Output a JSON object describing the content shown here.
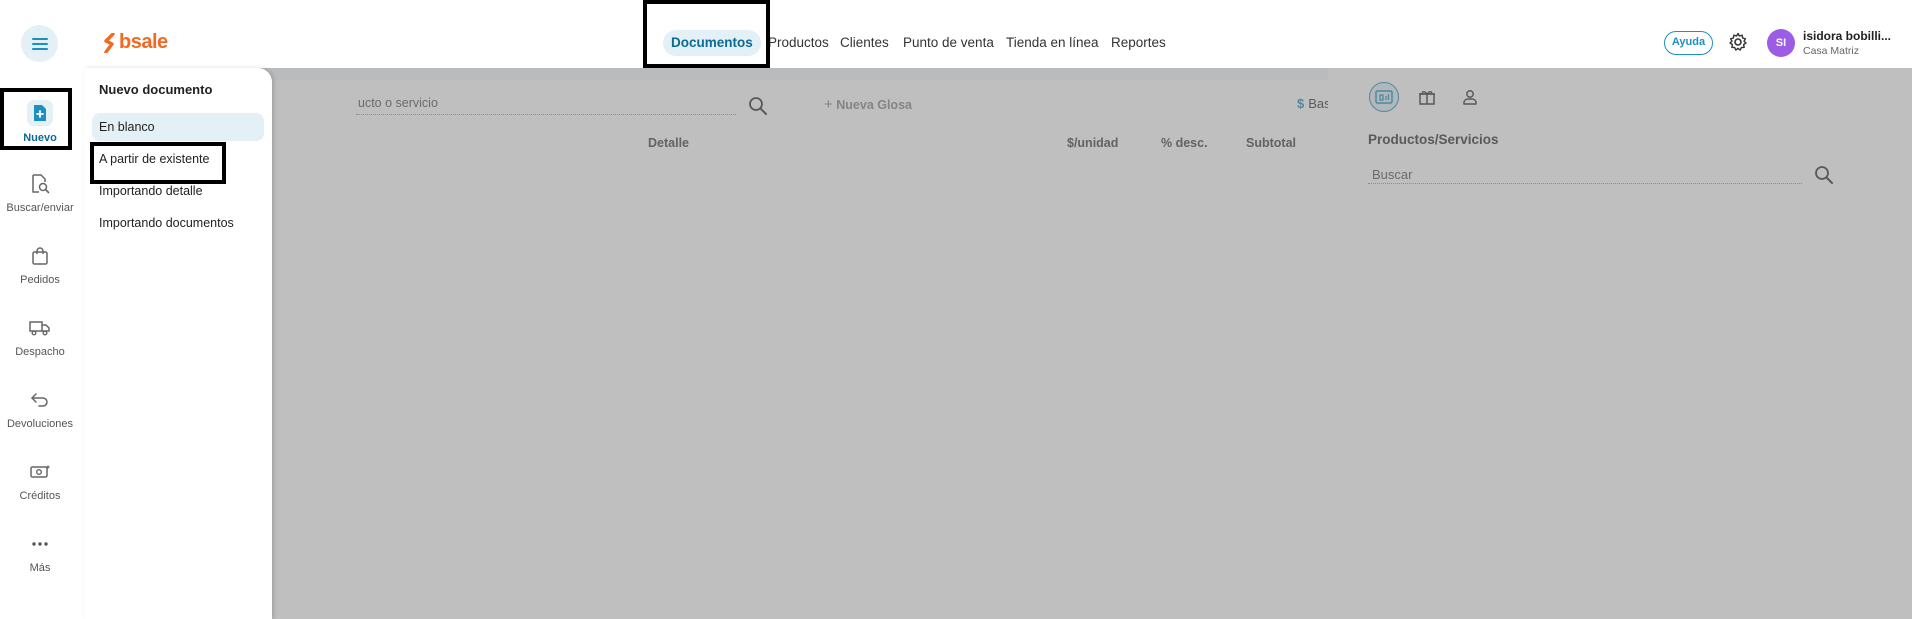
{
  "brand": {
    "name": "bsale",
    "color": "#f26a21"
  },
  "colors": {
    "accent": "#1f8fc1",
    "accent_dark": "#0b6a95",
    "accent_bg": "#e3f0f6",
    "avatar": "#9b5de5"
  },
  "header": {
    "nav": [
      "Documentos",
      "Productos",
      "Clientes",
      "Punto de venta",
      "Tienda en línea",
      "Reportes"
    ],
    "active_nav": "Documentos",
    "help_label": "Ayuda",
    "avatar_initials": "SI",
    "user_name": "isidora bobilli...",
    "user_branch": "Casa Matriz"
  },
  "rail": [
    {
      "label": "Nuevo",
      "icon": "new-document-icon",
      "active": true
    },
    {
      "label": "Buscar/enviar",
      "icon": "search-document-icon"
    },
    {
      "label": "Pedidos",
      "icon": "shopping-bag-icon"
    },
    {
      "label": "Despacho",
      "icon": "truck-icon"
    },
    {
      "label": "Devoluciones",
      "icon": "return-arrow-icon"
    },
    {
      "label": "Créditos",
      "icon": "money-icon"
    },
    {
      "label": "Más",
      "icon": "more-dots-icon"
    }
  ],
  "menu": {
    "title": "Nuevo documento",
    "items": [
      "En blanco",
      "A partir de existente",
      "Importando detalle",
      "Importando documentos"
    ],
    "active_item": "En blanco"
  },
  "document": {
    "search_placeholder": "ucto o servicio",
    "add_gloss": "Nueva Glosa",
    "price_list": "Base",
    "columns": [
      "Detalle",
      "$/unidad",
      "% desc.",
      "Subtotal"
    ]
  },
  "side_panel": {
    "tabs": [
      "pos-icon",
      "gift-icon",
      "user-icon"
    ],
    "title": "Productos/Servicios",
    "search_placeholder": "Buscar"
  }
}
